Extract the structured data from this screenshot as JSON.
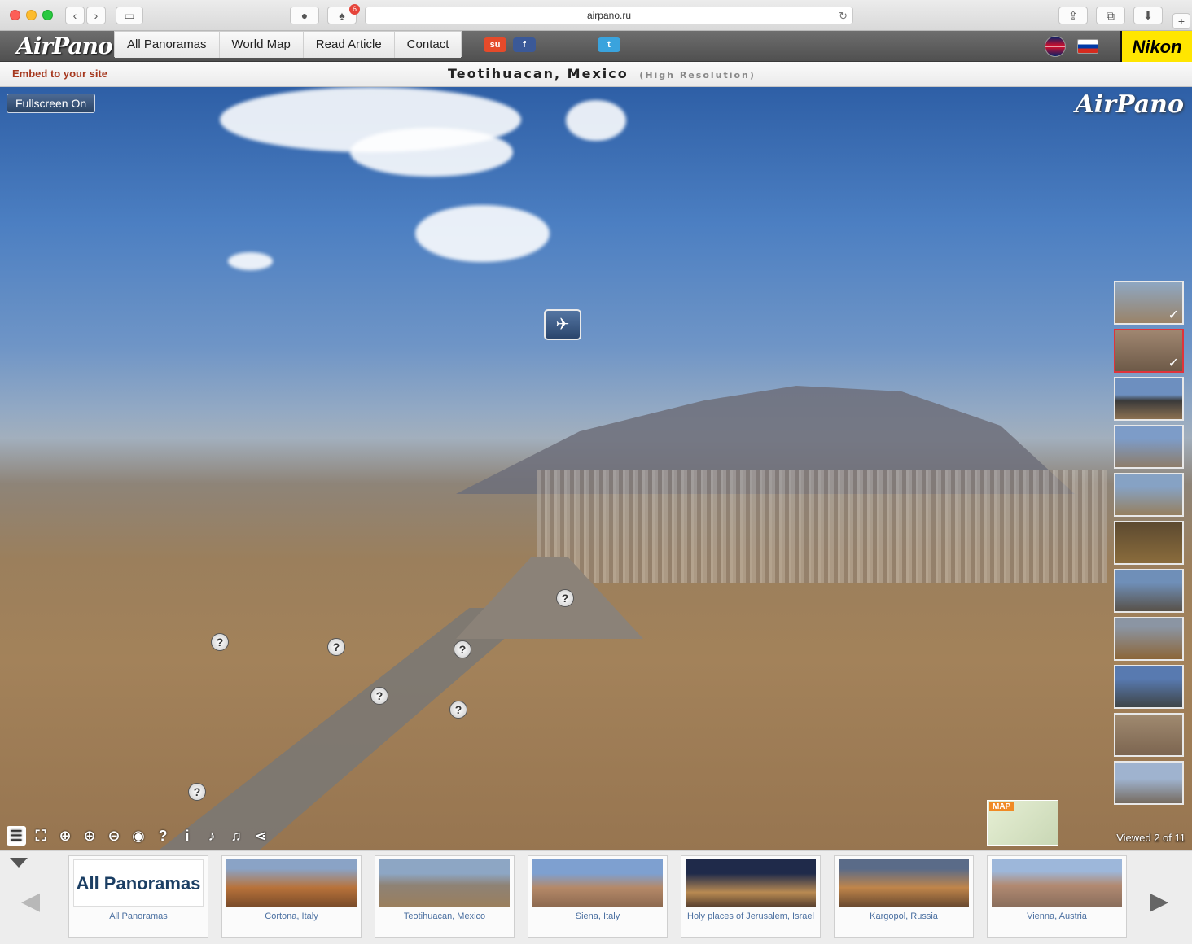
{
  "browser": {
    "url": "airpano.ru",
    "notification_count": "6"
  },
  "site": {
    "logo_text": "AirPano",
    "menu": [
      "All Panoramas",
      "World Map",
      "Read Article",
      "Contact"
    ],
    "sponsor": "Nikon"
  },
  "title_strip": {
    "embed_label": "Embed to your site",
    "title": "Teotihuacan, Mexico",
    "subtitle": "(High Resolution)"
  },
  "viewer": {
    "fullscreen_label": "Fullscreen On",
    "watermark": "AirPano",
    "map_label": "MAP",
    "viewed_text": "Viewed 2 of 11",
    "thumbnails_count": 11,
    "active_thumbnail": 2
  },
  "carousel": {
    "items": [
      {
        "title": "All Panoramas",
        "thumb_text": "All Panoramas"
      },
      {
        "title": "Cortona, Italy"
      },
      {
        "title": "Teotihuacan, Mexico"
      },
      {
        "title": "Siena, Italy"
      },
      {
        "title": "Holy places of Jerusalem, Israel"
      },
      {
        "title": "Kargopol, Russia"
      },
      {
        "title": "Vienna, Austria"
      }
    ]
  },
  "colors": {
    "accent_red": "#a5371d",
    "link_blue": "#4a6fa0",
    "nikon_yellow": "#ffe600"
  }
}
